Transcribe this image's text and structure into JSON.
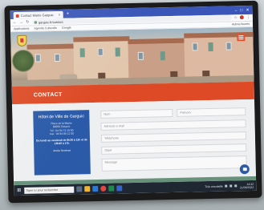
{
  "browser": {
    "tab_title": "Contact Mairie Garguic",
    "new_tab": "+",
    "window_controls": [
      "–",
      "□",
      "✕"
    ],
    "address": "garguic.fr/contact",
    "bookmarks": [
      "Applications",
      "Agenda Culturelle",
      "Google"
    ],
    "bookmarks_right": "Autres favoris"
  },
  "page": {
    "banner_title": "CONTACT",
    "sidebar": {
      "title": "Hôtel de Ville de Garguic",
      "lines": [
        "Place de la Mairie",
        "83000 Garguic",
        "Tél : 04 94 73 10 00",
        "Fax : 04 94 80 12 00"
      ],
      "note": "Du lundi au vendredi de 8h30 à 12h et de 13h30 à 17h",
      "more": "Accès Services"
    },
    "form": {
      "nom": "Nom",
      "prenom": "Prénom",
      "email": "Adresse e-mail",
      "telephone": "Téléphone",
      "objet": "Objet",
      "message": "Message"
    }
  },
  "taskbar": {
    "search_placeholder": "Taper ici pour rechercher",
    "weather": "Très ensoleillé",
    "time": "14:32",
    "date": "21/06/2022"
  },
  "colors": {
    "banner": "#dd4a25",
    "sidebar": "#2a5aa8",
    "browser_tabbar": "#3a56b8"
  }
}
